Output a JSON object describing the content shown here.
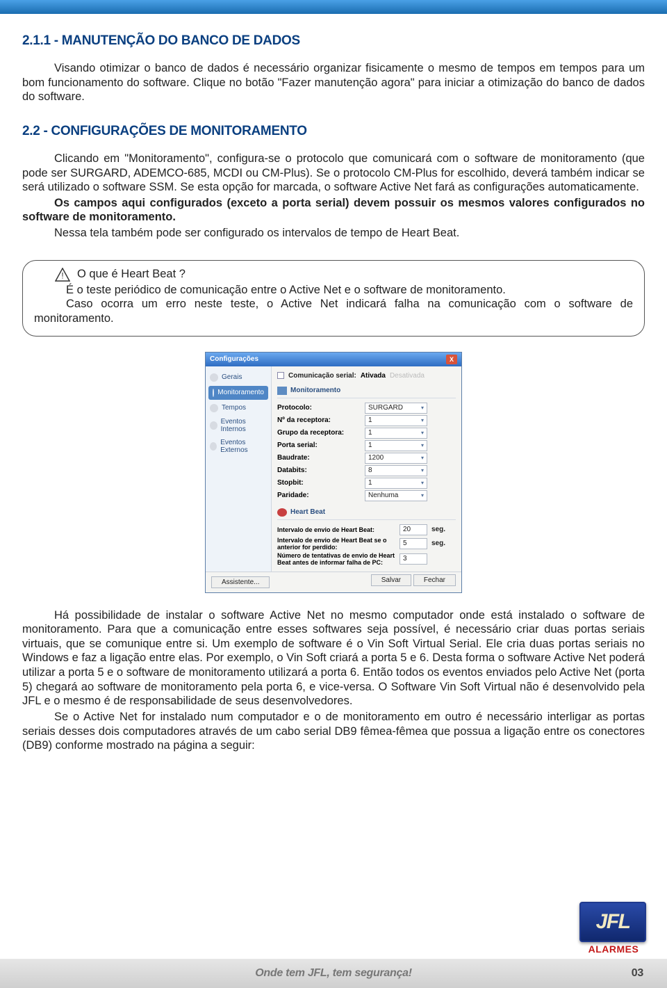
{
  "section1": {
    "heading": "2.1.1 - MANUTENÇÃO DO BANCO DE DADOS",
    "p1": "Visando otimizar o banco de dados é necessário organizar fisicamente o mesmo de tempos em tempos para um bom funcionamento do software. Clique no botão \"Fazer manutenção agora\" para iniciar a otimização do banco de dados do software."
  },
  "section2": {
    "heading": "2.2 - CONFIGURAÇÕES DE MONITORAMENTO",
    "p1": "Clicando em \"Monitoramento\", configura-se o protocolo que comunicará com o software de monitoramento (que pode ser SURGARD, ADEMCO-685, MCDI ou CM-Plus). Se o protocolo CM-Plus for escolhido, deverá também indicar se será utilizado o software SSM. Se esta opção for marcada, o software Active Net fará as configurações automaticamente.",
    "p2a": "Os campos aqui configurados (exceto a porta serial) devem possuir os mesmos valores configurados no software de monitoramento.",
    "p3": "Nessa tela também pode ser configurado os intervalos de tempo de Heart Beat."
  },
  "callout": {
    "q": "O que é Heart Beat ?",
    "a1": "É o teste periódico de comunicação entre o Active Net e o software de monitoramento.",
    "a2": "Caso ocorra um erro neste teste, o Active Net indicará falha na comunicação com o software de monitoramento."
  },
  "mock": {
    "title": "Configurações",
    "side": [
      "Gerais",
      "Monitoramento",
      "Tempos",
      "Eventos Internos",
      "Eventos Externos"
    ],
    "comserial_label": "Comunicação serial:",
    "comserial_on": "Ativada",
    "comserial_off": "Desativada",
    "sec_mon": "Monitoramento",
    "rows": [
      {
        "k": "Protocolo:",
        "v": "SURGARD"
      },
      {
        "k": "Nº da receptora:",
        "v": "1"
      },
      {
        "k": "Grupo da receptora:",
        "v": "1"
      },
      {
        "k": "Porta serial:",
        "v": "1"
      },
      {
        "k": "Baudrate:",
        "v": "1200"
      },
      {
        "k": "Databits:",
        "v": "8"
      },
      {
        "k": "Stopbit:",
        "v": "1"
      },
      {
        "k": "Paridade:",
        "v": "Nenhuma"
      }
    ],
    "sec_hb": "Heart Beat",
    "hb": [
      {
        "k": "Intervalo de envio de Heart Beat:",
        "v": "20",
        "u": "seg."
      },
      {
        "k": "Intervalo de envio de Heart Beat se o anterior for perdido:",
        "v": "5",
        "u": "seg."
      },
      {
        "k": "Número de tentativas de envio de Heart Beat antes de informar falha de PC:",
        "v": "3",
        "u": ""
      }
    ],
    "assist": "Assistente...",
    "save": "Salvar",
    "close": "Fechar"
  },
  "section3": {
    "p1": "Há possibilidade de instalar o software Active Net no mesmo computador onde está instalado o software de monitoramento. Para que a comunicação entre esses softwares seja possível, é necessário criar duas portas seriais virtuais, que se comunique entre si. Um exemplo de software é o Vin Soft Virtual Serial. Ele cria duas portas seriais no Windows e faz a ligação entre elas. Por exemplo, o Vin Soft criará a porta 5 e 6. Desta forma o software Active Net poderá utilizar a porta 5 e o software de monitoramento utilizará a porta 6. Então todos os eventos enviados pelo Active Net (porta 5) chegará ao software de monitoramento pela porta 6, e vice-versa. O Software Vin Soft Virtual não é desenvolvido pela JFL e o mesmo é de responsabilidade de seus desenvolvedores.",
    "p2": "Se o Active Net for instalado num computador e o de monitoramento em outro é necessário interligar as portas seriais desses dois computadores através de um cabo serial DB9 fêmea-fêmea que possua a ligação entre os conectores (DB9) conforme mostrado na página a seguir:"
  },
  "footer": {
    "slogan": "Onde tem JFL, tem segurança!",
    "page": "03"
  },
  "logo": {
    "text": "JFL",
    "sub": "ALARMES"
  }
}
